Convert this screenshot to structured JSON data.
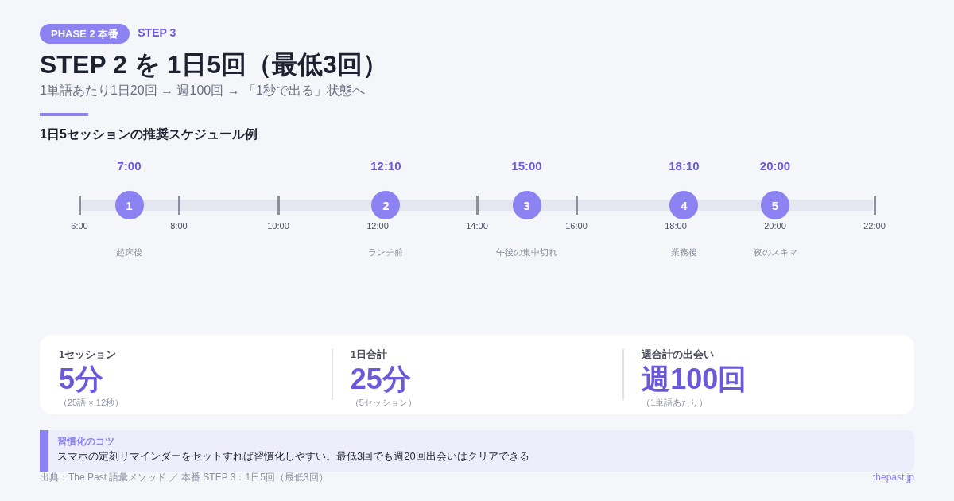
{
  "header": {
    "badge": "PHASE 2 本番",
    "step": "STEP 3",
    "title": "STEP 2 を 1日5回（最低3回）",
    "subtitle": "1単語あたり1日20回 → 週100回 → 「1秒で出る」状態へ"
  },
  "section_title": "1日5セッションの推奨スケジュール例",
  "timeline": {
    "ticks": [
      "6:00",
      "8:00",
      "10:00",
      "12:00",
      "14:00",
      "16:00",
      "18:00",
      "20:00",
      "22:00"
    ],
    "sessions": [
      {
        "number": "1",
        "time": "7:00",
        "note": "起床後"
      },
      {
        "number": "2",
        "time": "12:10",
        "note": "ランチ前"
      },
      {
        "number": "3",
        "time": "15:00",
        "note": "午後の集中切れ"
      },
      {
        "number": "4",
        "time": "18:10",
        "note": "業務後"
      },
      {
        "number": "5",
        "time": "20:00",
        "note": "夜のスキマ"
      }
    ]
  },
  "stats": [
    {
      "label": "1セッション",
      "value": "5分",
      "note": "（25語 × 12秒）"
    },
    {
      "label": "1日合計",
      "value": "25分",
      "note": "（5セッション）"
    },
    {
      "label": "週合計の出会い",
      "value": "週100回",
      "note": "（1単語あたり）"
    }
  ],
  "tip": {
    "title": "習慣化のコツ",
    "text": "スマホの定刻リマインダーをセットすれば習慣化しやすい。最低3回でも週20回出会いはクリアできる"
  },
  "footer": {
    "source": "出典：The Past 語彙メソッド ／ 本番 STEP 3：1日5回（最低3回）",
    "site": "thepast.jp"
  }
}
